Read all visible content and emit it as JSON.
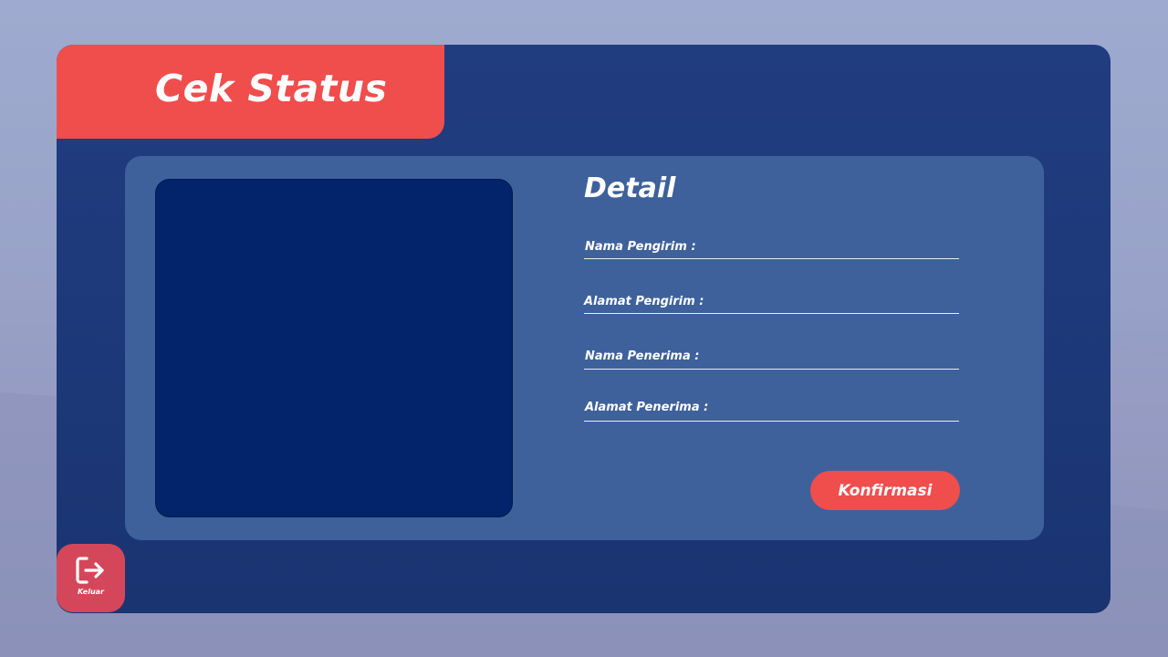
{
  "header": {
    "title": "Cek Status"
  },
  "detail": {
    "title": "Detail",
    "fields": [
      {
        "label": "Nama Pengirim :",
        "value": ""
      },
      {
        "label": "Alamat Pengirim :",
        "value": ""
      },
      {
        "label": "Nama Penerima :",
        "value": ""
      },
      {
        "label": "Alamat Penerima :",
        "value": ""
      }
    ],
    "confirm_label": "Konfirmasi"
  },
  "footer": {
    "exit_label": "Keluar",
    "exit_icon": "logout-icon"
  },
  "colors": {
    "accent": "#f04d4d",
    "window": "#1f3b7d",
    "panel": "#3e619b",
    "image_box": "#03236b"
  }
}
